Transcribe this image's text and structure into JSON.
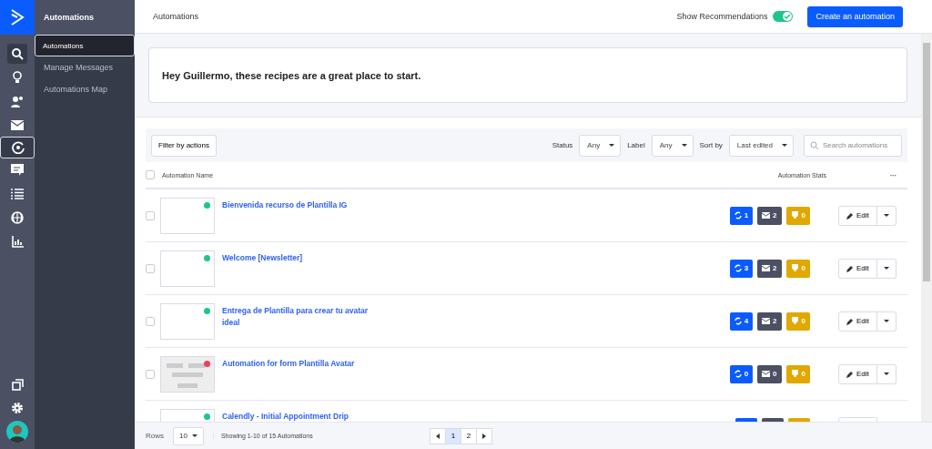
{
  "rail": {
    "top": [
      {
        "kind": "search",
        "selected": false
      },
      {
        "kind": "bulb",
        "selected": false
      },
      {
        "kind": "contacts",
        "selected": false
      },
      {
        "kind": "mail",
        "selected": false
      },
      {
        "kind": "automations",
        "selected": true
      },
      {
        "kind": "chat",
        "selected": false
      },
      {
        "kind": "list",
        "selected": false
      },
      {
        "kind": "globe",
        "selected": false
      },
      {
        "kind": "chart",
        "selected": false
      }
    ],
    "bottom": [
      {
        "kind": "copy",
        "selected": false
      },
      {
        "kind": "gear",
        "selected": false
      },
      {
        "kind": "avatar",
        "selected": false
      }
    ]
  },
  "sidebar": {
    "title": "Automations",
    "items": [
      {
        "label": "Automations",
        "selected": true
      },
      {
        "label": "Manage Messages",
        "selected": false
      },
      {
        "label": "Automations Map",
        "selected": false
      }
    ]
  },
  "header": {
    "title": "Automations",
    "toggle": {
      "label": "Show Recommendations",
      "on": true
    },
    "create_button": "Create an automation"
  },
  "recommendations": {
    "greeting": "Hey Guillermo, these recipes are a great place to start."
  },
  "filters": {
    "filter_button": "Filter by actions",
    "selects": [
      {
        "label": "Status",
        "value": "Any"
      },
      {
        "label": "Label",
        "value": "Any"
      },
      {
        "label": "Sort by",
        "value": "Last edited"
      }
    ],
    "search": {
      "placeholder": "Search automations"
    }
  },
  "table": {
    "select_all_checked": false,
    "columns": [
      "Automation Name",
      "Automation Stats",
      "···"
    ],
    "rows": [
      {
        "checked": false,
        "kind": "blank",
        "color": "#1fc58e",
        "name": "Bienvenida recurso de Plantilla IG",
        "stats": [
          {
            "kind": "contacts",
            "value": "1"
          },
          {
            "kind": "emails",
            "value": "2"
          },
          {
            "kind": "goals",
            "value": "0"
          }
        ],
        "action": "Edit"
      },
      {
        "checked": false,
        "kind": "blank",
        "color": "#1fc58e",
        "name": "Welcome [Newsletter]",
        "stats": [
          {
            "kind": "contacts",
            "value": "3"
          },
          {
            "kind": "emails",
            "value": "2"
          },
          {
            "kind": "goals",
            "value": "0"
          }
        ],
        "action": "Edit"
      },
      {
        "checked": false,
        "kind": "blank",
        "color": "#1fc58e",
        "name": "Entrega de Plantilla para crear tu avatar ideal",
        "stats": [
          {
            "kind": "contacts",
            "value": "4"
          },
          {
            "kind": "emails",
            "value": "2"
          },
          {
            "kind": "goals",
            "value": "0"
          }
        ],
        "action": "Edit"
      },
      {
        "checked": false,
        "kind": "diagram",
        "color": "#f03e5c",
        "name": "Automation for form Plantilla Avatar",
        "stats": [
          {
            "kind": "contacts",
            "value": "0"
          },
          {
            "kind": "emails",
            "value": "0"
          },
          {
            "kind": "goals",
            "value": "0"
          }
        ],
        "action": "Edit"
      },
      {
        "kind": "blank",
        "color": "#1fc58e",
        "name": "Calendly - Initial Appointment Drip",
        "stats": [
          {
            "kind": "contacts"
          },
          {
            "kind": "emails"
          },
          {
            "kind": "goals"
          }
        ]
      }
    ]
  },
  "footer": {
    "rows_label": "Rows",
    "rows_value": "10",
    "summary": "Showing 1-10 of 15 Automations",
    "pages": [
      {
        "label": "1",
        "selected": true
      },
      {
        "label": "2",
        "selected": false
      }
    ]
  }
}
